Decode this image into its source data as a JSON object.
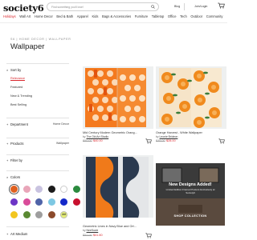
{
  "header": {
    "logo": "society6",
    "search_placeholder": "Find something you'll love!",
    "blog": "Blog",
    "join_login": "Join/Login"
  },
  "nav": [
    "Holidays",
    "Wall Art",
    "Home Decor",
    "Bed & Bath",
    "Apparel",
    "Kids",
    "Bags & Accessories",
    "Furniture",
    "Tabletop",
    "Office",
    "Tech",
    "Outdoor",
    "Community"
  ],
  "breadcrumb": "S6 | HOME DECOR | WALLPAPER",
  "page_title": "Wallpaper",
  "sidebar": {
    "sort_label": "Sort by",
    "sort_options": [
      "Relevance",
      "Featured",
      "New & Trending",
      "Best Selling"
    ],
    "department_label": "Department",
    "department_value": "Home Decor",
    "products_label": "Products",
    "products_value": "Wallpaper",
    "filter_label": "Filter by",
    "colors_label": "Colors",
    "colors": [
      "#e0601f",
      "#e9a6b9",
      "#c9c3e0",
      "#1b1b1b",
      "#ffffff",
      "#2b8a3e",
      "#6d36c6",
      "#d94c9a",
      "#4f63a8",
      "#7ec8e3",
      "#1428c9",
      "#c8102e",
      "#f2c61f",
      "#5a8a32",
      "#9e9e9e",
      "#8b4a2b",
      "#e7f075"
    ],
    "all_label": "All",
    "art_medium_label": "Art Medium"
  },
  "products": [
    {
      "title": "Mid Century Modern Geometric Orang...",
      "by": "by",
      "artist": "The Old Art Studio",
      "old_price": "$50.00",
      "new_price": "$40.00"
    },
    {
      "title": "Orange Harvest - White Wallpaper",
      "by": "by",
      "artist": "Leonie Brideon",
      "old_price": "$35.00",
      "new_price": "$28.00"
    },
    {
      "title": "Geometric Lines in Navy Blue and Ort...",
      "by": "by",
      "artist": "NeeSuzie",
      "old_price": "$52.00",
      "new_price": "$41.60"
    }
  ],
  "promo": {
    "title": "New Designs Added!",
    "subtitle": "Limited Edition Framed Posters Exclusively at Society6",
    "button": "SHOP COLLECTION"
  }
}
